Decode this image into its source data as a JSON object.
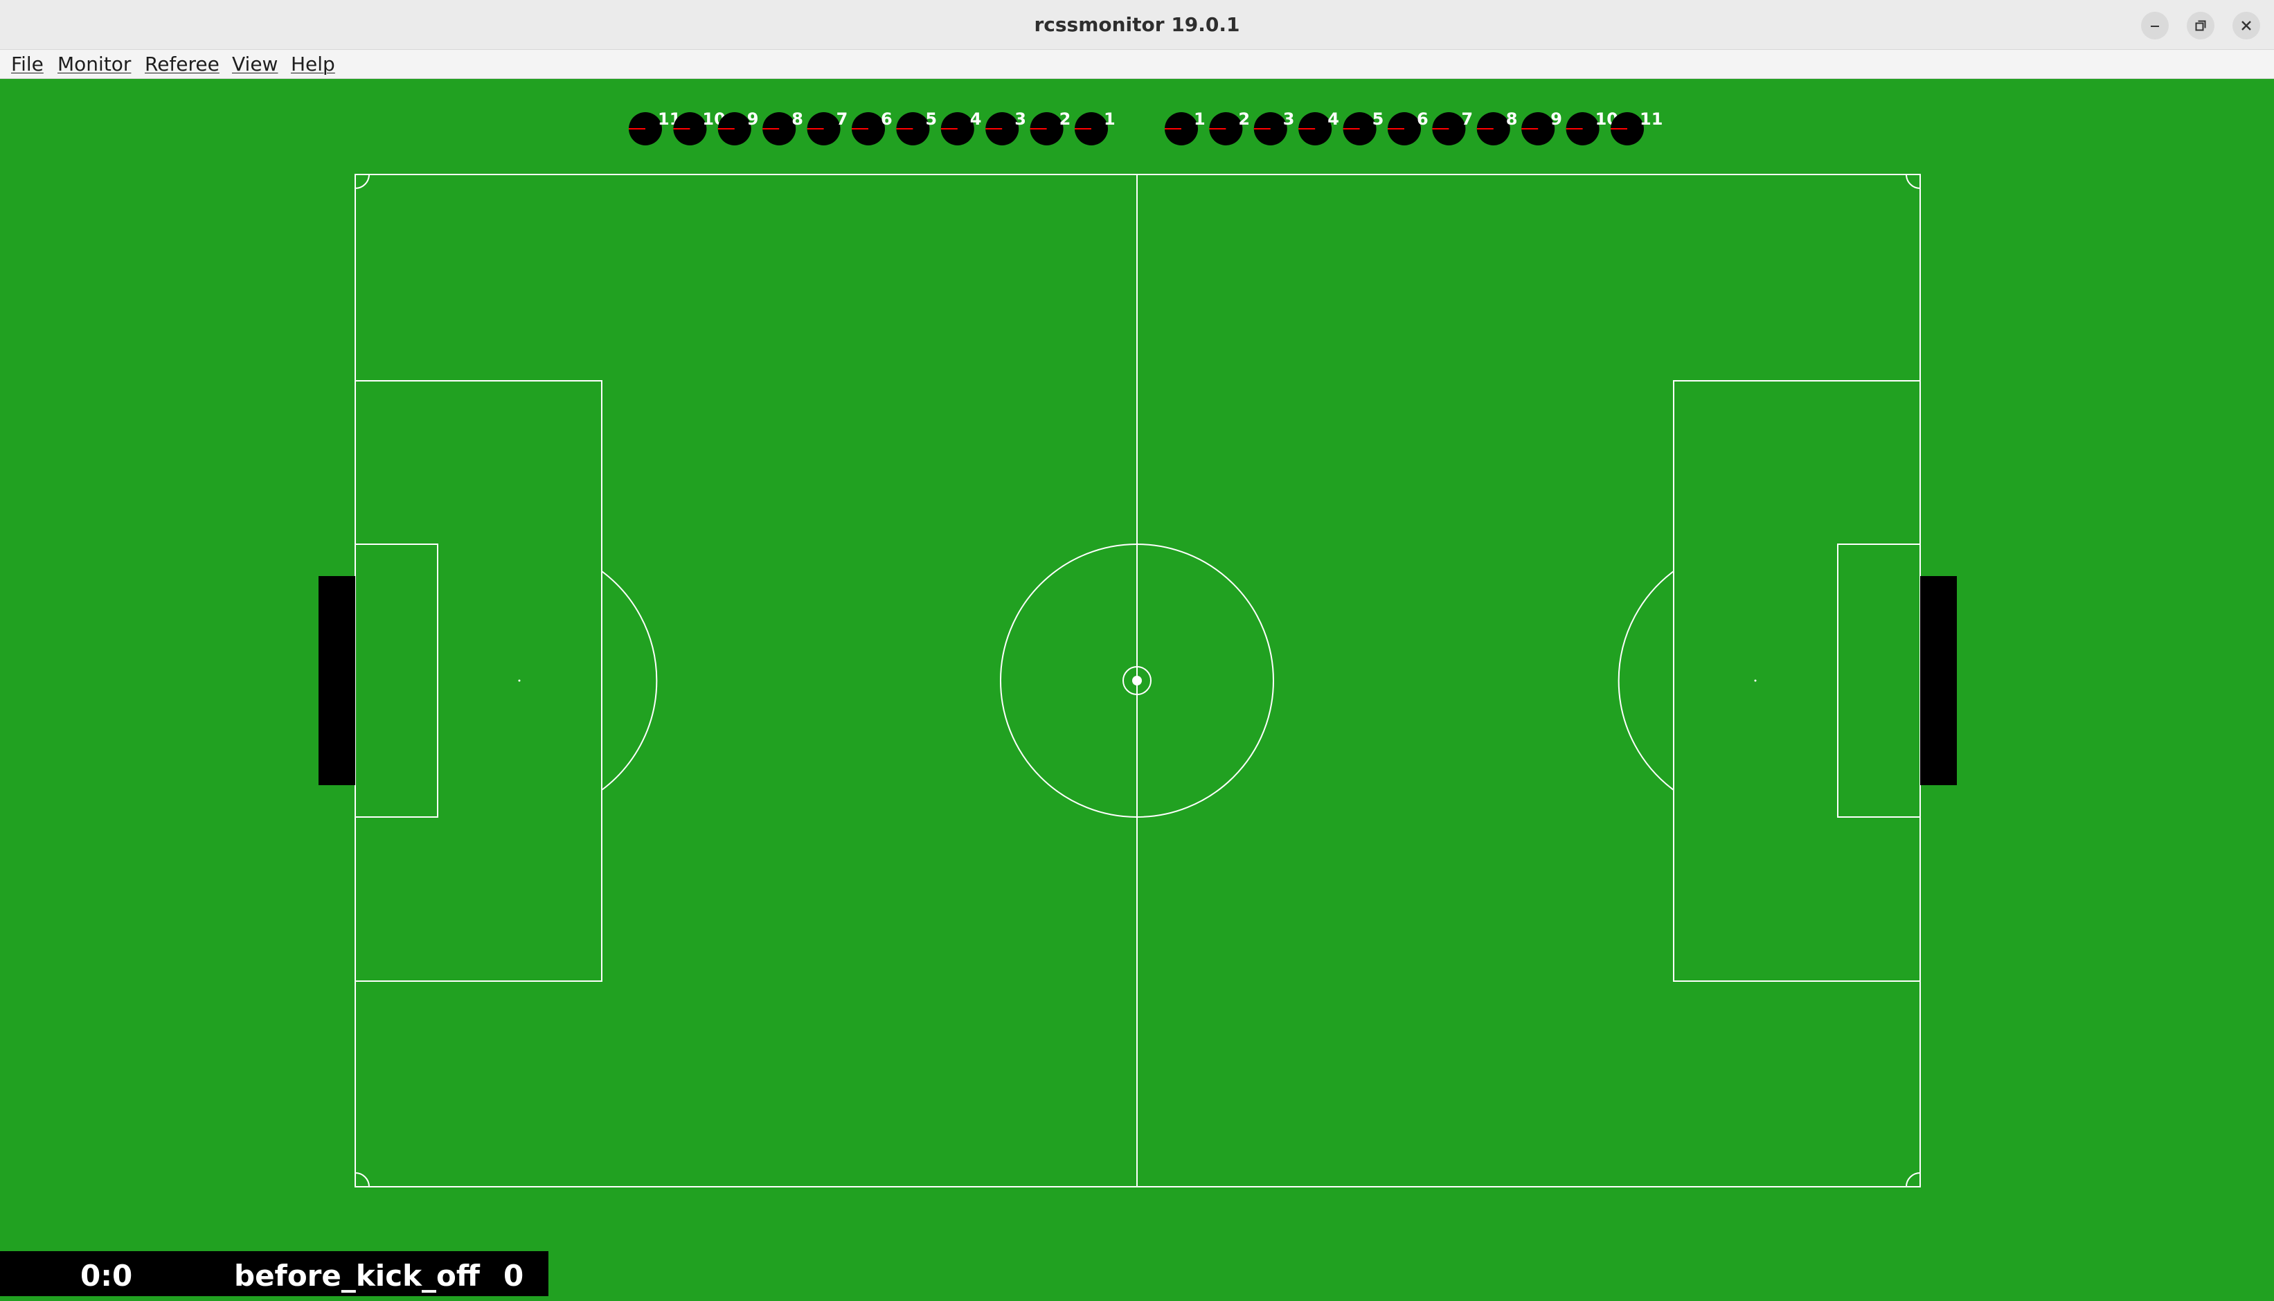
{
  "window": {
    "title": "rcssmonitor 19.0.1"
  },
  "title_bar_buttons": [
    {
      "name": "minimize",
      "icon": "minimize-icon"
    },
    {
      "name": "maximize",
      "icon": "maximize-icon"
    },
    {
      "name": "close",
      "icon": "close-icon"
    }
  ],
  "menu": [
    {
      "label": "File"
    },
    {
      "label": "Monitor"
    },
    {
      "label": "Referee"
    },
    {
      "label": "View"
    },
    {
      "label": "Help"
    }
  ],
  "field": {
    "grass_color": "#21a121",
    "line_color": "#ffffff",
    "goal_color": "#000000"
  },
  "teams": {
    "left": {
      "player_color": "#000000",
      "direction_color": "#ff0000",
      "players": [
        "11",
        "10",
        "9",
        "8",
        "7",
        "6",
        "5",
        "4",
        "3",
        "2",
        "1"
      ]
    },
    "right": {
      "player_color": "#000000",
      "direction_color": "#ff0000",
      "players": [
        "1",
        "2",
        "3",
        "4",
        "5",
        "6",
        "7",
        "8",
        "9",
        "10",
        "11"
      ]
    }
  },
  "status": {
    "score": "0:0",
    "play_mode": "before_kick_off",
    "time": "0"
  }
}
